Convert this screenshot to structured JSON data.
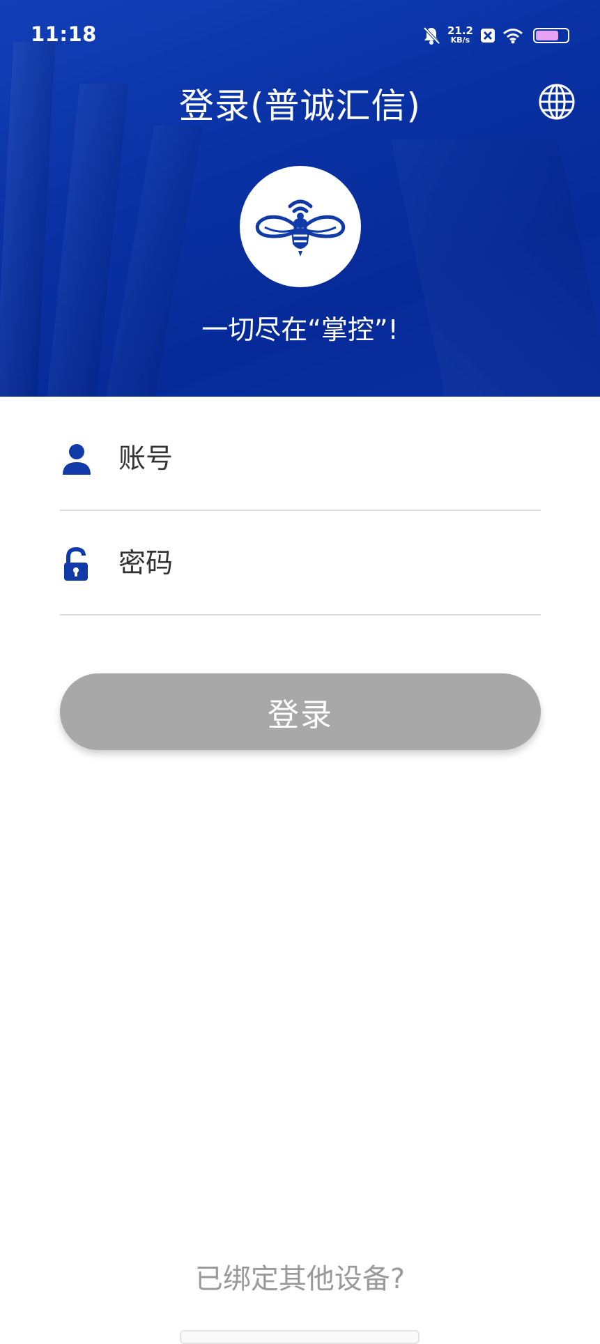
{
  "status_bar": {
    "time": "11:18",
    "net_speed_value": "21.2",
    "net_speed_unit": "KB/s",
    "icons": [
      "bell-off-icon",
      "x-notification-icon",
      "wifi-icon",
      "battery-icon"
    ],
    "battery_level": 0.72
  },
  "header": {
    "title": "登录(普诚汇信)",
    "slogan": "一切尽在“掌控”!",
    "language_icon": "globe-icon",
    "logo": "bee-wifi-logo",
    "background_color": "#0a33a6"
  },
  "form": {
    "account": {
      "icon": "user-icon",
      "placeholder": "账号",
      "value": ""
    },
    "password": {
      "icon": "unlock-icon",
      "placeholder": "密码",
      "value": ""
    },
    "login_label": "登录"
  },
  "footer": {
    "bound_other_device": "已绑定其他设备?"
  },
  "colors": {
    "brand_blue": "#0a33a6",
    "icon_blue": "#0f3aa8",
    "button_gray": "#a8a8a8",
    "link_gray": "#9a9a9a"
  }
}
